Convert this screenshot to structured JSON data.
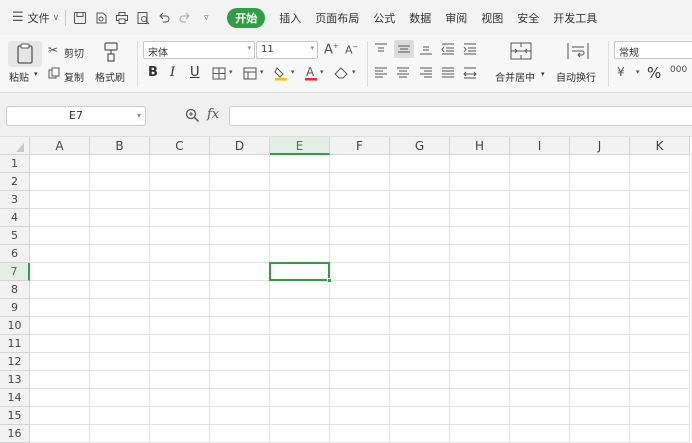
{
  "menubar": {
    "file_label": "文件",
    "tabs": [
      {
        "label": "开始",
        "active": true
      },
      {
        "label": "插入"
      },
      {
        "label": "页面布局"
      },
      {
        "label": "公式"
      },
      {
        "label": "数据"
      },
      {
        "label": "审阅"
      },
      {
        "label": "视图"
      },
      {
        "label": "安全"
      },
      {
        "label": "开发工具"
      }
    ]
  },
  "ribbon": {
    "paste_label": "粘贴",
    "cut_label": "剪切",
    "copy_label": "复制",
    "format_painter_label": "格式刷",
    "font_name": "宋体",
    "font_size": "11",
    "bold": "B",
    "italic": "I",
    "underline": "U",
    "merge_label": "合并居中",
    "wrap_label": "自动换行",
    "number_format": "常规",
    "percent": "%"
  },
  "formula_bar": {
    "name_box": "E7",
    "fx_label": "fx",
    "formula_value": ""
  },
  "sheet": {
    "columns": [
      "A",
      "B",
      "C",
      "D",
      "E",
      "F",
      "G",
      "H",
      "I",
      "J",
      "K"
    ],
    "rows": [
      "1",
      "2",
      "3",
      "4",
      "5",
      "6",
      "7",
      "8",
      "9",
      "10",
      "11",
      "12",
      "13",
      "14",
      "15",
      "16"
    ],
    "selected_cell": "E7",
    "selected_column": "E",
    "selected_row": "7"
  },
  "colors": {
    "accent": "#2f9e44",
    "selection_header_bg": "#e2efe4"
  }
}
